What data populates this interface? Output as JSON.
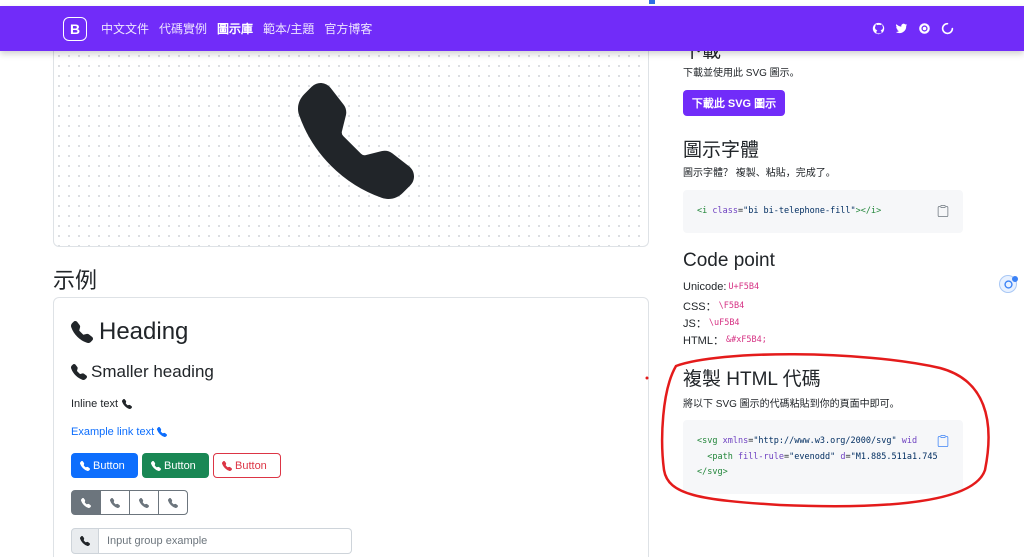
{
  "nav": {
    "brand": "B",
    "links": [
      "中文文件",
      "代碼實例",
      "圖示庫",
      "範本/主題",
      "官方博客"
    ],
    "active_index": 2,
    "icons": [
      "github-icon",
      "twitter-icon",
      "opencollective-icon",
      "loading-icon"
    ]
  },
  "examples": {
    "title": "示例",
    "heading": "Heading",
    "smaller_heading": "Smaller heading",
    "inline_text": "Inline text",
    "link_text": "Example link text",
    "buttons": [
      "Button",
      "Button",
      "Button"
    ],
    "input_placeholder": "Input group example"
  },
  "download": {
    "heading": "下載",
    "text": "下載並使用此 SVG 圖示。",
    "button": "下載此 SVG 圖示"
  },
  "icon_font": {
    "heading": "圖示字體",
    "text": "圖示字體？ 複製、粘貼，完成了。",
    "code_tag_open": "<i ",
    "code_attr": "class",
    "code_eq": "=",
    "code_value": "\"bi bi-telephone-fill\"",
    "code_tag_close": "></i>"
  },
  "code_point": {
    "heading": "Code point",
    "rows": [
      {
        "label": "Unicode:",
        "value": "U+F5B4"
      },
      {
        "label": "CSS：",
        "value": "\\F5B4"
      },
      {
        "label": "JS：",
        "value": "\\uF5B4"
      },
      {
        "label": "HTML：",
        "value": "&#xF5B4;"
      }
    ]
  },
  "copy_html": {
    "heading": "複製 HTML 代碼",
    "text": "將以下 SVG 圖示的代碼粘貼到你的頁面中即可。",
    "line1_tag": "<svg ",
    "line1_attr": "xmlns",
    "line1_value": "\"http://www.w3.org/2000/svg\"",
    "line1_tail": " wid",
    "line2_tag": "  <path ",
    "line2_attr1": "fill-rule",
    "line2_value1": "\"evenodd\"",
    "line2_attr2": " d",
    "line2_value2": "\"M1.885.511a1.745",
    "line3": "</svg>"
  },
  "colors": {
    "brand_purple": "#712cf9",
    "primary": "#0d6efd",
    "success": "#198754",
    "danger": "#dc3545",
    "annotation_red": "#e41b1b"
  }
}
